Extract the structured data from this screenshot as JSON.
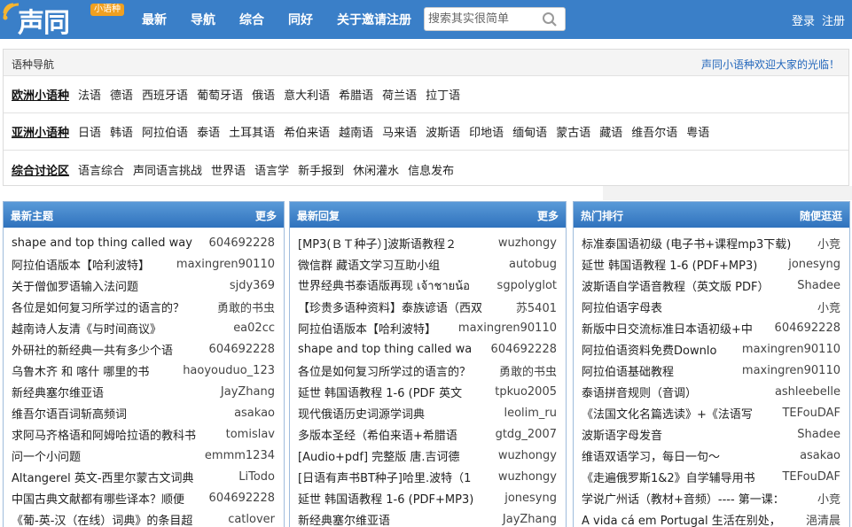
{
  "header": {
    "logo_text": "声同",
    "logo_badge": "小语种",
    "nav": [
      "最新",
      "导航",
      "综合",
      "同好",
      "关于邀请注册"
    ],
    "search_placeholder": "搜索其实很简单",
    "login": "登录",
    "register": "注册",
    "colors": {
      "bar": "#3a7fc8",
      "badge": "#f0a020"
    }
  },
  "langnav": {
    "title": "语种导航",
    "welcome": "声同小语种欢迎大家的光临！",
    "rows": [
      {
        "category": "欧洲小语种",
        "items": [
          "法语",
          "德语",
          "西班牙语",
          "葡萄牙语",
          "俄语",
          "意大利语",
          "希腊语",
          "荷兰语",
          "拉丁语"
        ]
      },
      {
        "category": "亚洲小语种",
        "items": [
          "日语",
          "韩语",
          "阿拉伯语",
          "泰语",
          "土耳其语",
          "希伯来语",
          "越南语",
          "马来语",
          "波斯语",
          "印地语",
          "缅甸语",
          "蒙古语",
          "藏语",
          "维吾尔语",
          "粤语"
        ]
      },
      {
        "category": "综合讨论区",
        "items": [
          "语言综合",
          "声同语言挑战",
          "世界语",
          "语言学",
          "新手报到",
          "休闲灌水",
          "信息发布"
        ]
      }
    ]
  },
  "columns": [
    {
      "title": "最新主题",
      "more": "更多",
      "items": [
        {
          "t": "shape and top thing called way",
          "u": "604692228"
        },
        {
          "t": "阿拉伯语版本【哈利波特】",
          "u": "maxingren90110"
        },
        {
          "t": "关于僧伽罗语输入法问题",
          "u": "sjdy369"
        },
        {
          "t": "各位是如何复习所学过的语言的？",
          "u": "勇敢的书虫"
        },
        {
          "t": "越南诗人友清《与时间商议》",
          "u": "ea02cc"
        },
        {
          "t": "外研社的新经典一共有多少个语",
          "u": "604692228"
        },
        {
          "t": "乌鲁木齐 和 喀什 哪里的书",
          "u": "haoyouduo_123"
        },
        {
          "t": "新经典塞尔维亚语",
          "u": "JayZhang"
        },
        {
          "t": "维吾尔语百词斩高频词",
          "u": "asakao"
        },
        {
          "t": "求阿马齐格语和阿姆哈拉语的教科书",
          "u": "tomislav"
        },
        {
          "t": "问一个小问题",
          "u": "emmm1234"
        },
        {
          "t": "Altangerel 英文-西里尔蒙古文词典",
          "u": "LiTodo"
        },
        {
          "t": "中国古典文献都有哪些译本？顺便",
          "u": "604692228"
        },
        {
          "t": "《葡-英-汉（在线）词典》的条目超",
          "u": "catlover"
        }
      ]
    },
    {
      "title": "最新回复",
      "more": "更多",
      "items": [
        {
          "t": "[MP3(ＢＴ种子）]波斯语教程２",
          "u": "wuzhongy"
        },
        {
          "t": "微信群 藏语文学习互助小组",
          "u": "autobug"
        },
        {
          "t": "世界经典书泰语版再现 เจ้าชายน้อ",
          "u": "sgpolyglot"
        },
        {
          "t": "【珍贵多语种资料】泰族谚语（西双",
          "u": "苏5401"
        },
        {
          "t": "阿拉伯语版本【哈利波特】",
          "u": "maxingren90110"
        },
        {
          "t": "shape and top thing called wa",
          "u": "604692228"
        },
        {
          "t": "各位是如何复习所学过的语言的？",
          "u": "勇敢的书虫"
        },
        {
          "t": "延世 韩国语教程 1-6 (PDF 英文",
          "u": "tpkuo2005"
        },
        {
          "t": "现代俄语历史词源学词典",
          "u": "leolim_ru"
        },
        {
          "t": "多版本圣经（希伯来语+希腊语",
          "u": "gtdg_2007"
        },
        {
          "t": "[Audio+pdf] 完整版 唐.吉诃德",
          "u": "wuzhongy"
        },
        {
          "t": "[日语有声书BT种子]哈里.波特（1",
          "u": "wuzhongy"
        },
        {
          "t": "延世 韩国语教程 1-6 (PDF+MP3)",
          "u": "jonesyng"
        },
        {
          "t": "新经典塞尔维亚语",
          "u": "JayZhang"
        }
      ]
    },
    {
      "title": "热门排行",
      "more": "随便逛逛",
      "items": [
        {
          "t": "标准泰国语初级 (电子书+课程mp3下载)",
          "u": "小竞"
        },
        {
          "t": "延世 韩国语教程 1-6 (PDF+MP3)",
          "u": "jonesyng"
        },
        {
          "t": "波斯语自学语音教程（英文版 PDF）",
          "u": "Shadee"
        },
        {
          "t": "阿拉伯语字母表",
          "u": "小竞"
        },
        {
          "t": "新版中日交流标准日本语初级+中",
          "u": "604692228"
        },
        {
          "t": "阿拉伯语资料免费Downlo",
          "u": "maxingren90110"
        },
        {
          "t": "阿拉伯语基础教程",
          "u": "maxingren90110"
        },
        {
          "t": "泰语拼音规则（音调）",
          "u": "ashleebelle"
        },
        {
          "t": "《法国文化名篇选读》+《法语写",
          "u": "TEFouDAF"
        },
        {
          "t": "波斯语字母发音",
          "u": "Shadee"
        },
        {
          "t": "维语双语学习，每日一句～",
          "u": "asakao"
        },
        {
          "t": "《走遍俄罗斯1&2》自学辅导用书",
          "u": "TEFouDAF"
        },
        {
          "t": "学说广州话（教材+音频）---- 第一课：",
          "u": "小竞"
        },
        {
          "t": "A vida cá em Portugal 生活在别处，",
          "u": "浥清晨"
        }
      ]
    }
  ]
}
